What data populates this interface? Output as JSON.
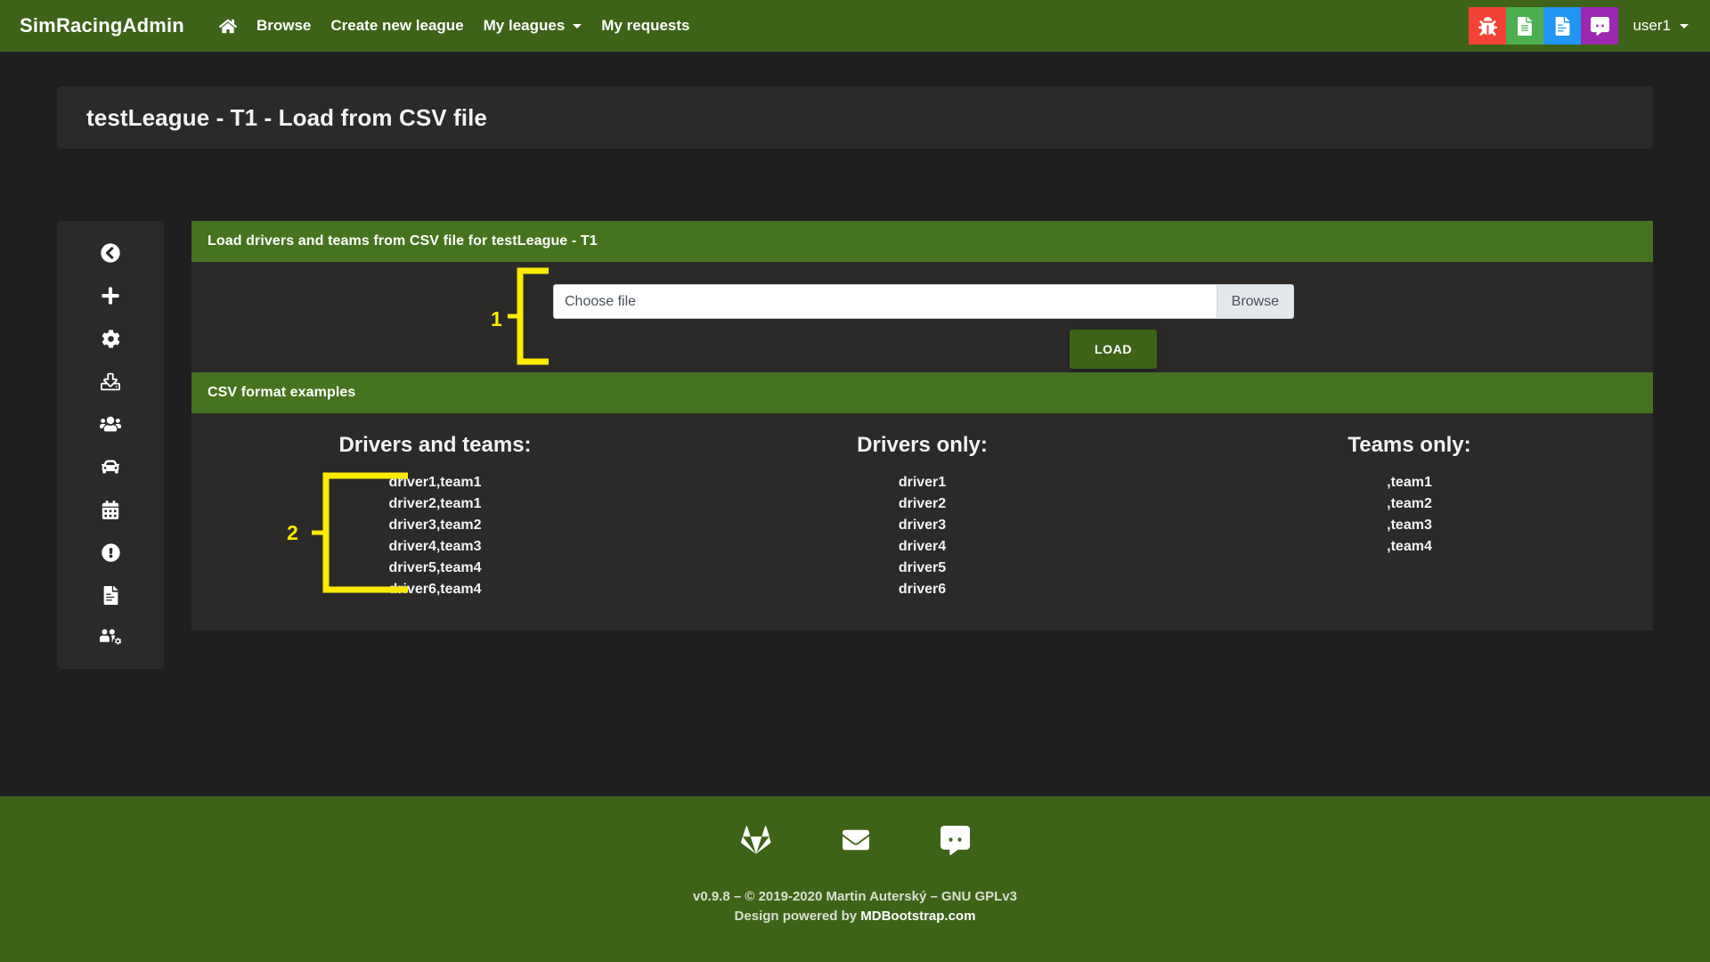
{
  "navbar": {
    "brand": "SimRacingAdmin",
    "home_icon": "home-icon",
    "links": [
      {
        "label": "Browse",
        "name": "nav-browse"
      },
      {
        "label": "Create new league",
        "name": "nav-create-new-league"
      },
      {
        "label": "My leagues",
        "name": "nav-my-leagues",
        "dropdown": true
      },
      {
        "label": "My requests",
        "name": "nav-my-requests"
      }
    ],
    "actions": [
      {
        "icon": "bug-icon",
        "color": "#f44336"
      },
      {
        "icon": "file-lines-icon",
        "color": "#4caf50"
      },
      {
        "icon": "file-signature-icon",
        "color": "#2196f3"
      },
      {
        "icon": "discord-icon",
        "color": "#9c27b0"
      }
    ],
    "user": "user1"
  },
  "page": {
    "title": "testLeague - T1 - Load from CSV file"
  },
  "sidebar": {
    "items": [
      {
        "icon": "circle-chevron-left-icon",
        "name": "sidebar-item-back"
      },
      {
        "icon": "plus-icon",
        "name": "sidebar-item-add"
      },
      {
        "icon": "gear-icon",
        "name": "sidebar-item-settings"
      },
      {
        "icon": "upload-icon",
        "name": "sidebar-item-upload"
      },
      {
        "icon": "users-icon",
        "name": "sidebar-item-drivers"
      },
      {
        "icon": "car-icon",
        "name": "sidebar-item-cars"
      },
      {
        "icon": "calendar-icon",
        "name": "sidebar-item-calendar"
      },
      {
        "icon": "exclamation-circle-icon",
        "name": "sidebar-item-penalties"
      },
      {
        "icon": "file-lines-icon",
        "name": "sidebar-item-results"
      },
      {
        "icon": "users-gear-icon",
        "name": "sidebar-item-manage-users"
      }
    ]
  },
  "upload_card": {
    "header": "Load drivers and teams from CSV file for testLeague - T1",
    "file_input_value": "Choose file",
    "file_input_placeholder": "Choose file",
    "browse_label": "Browse",
    "load_label": "LOAD"
  },
  "examples_card": {
    "header": "CSV format examples",
    "columns": [
      {
        "heading": "Drivers and teams:",
        "lines": [
          "driver1,team1",
          "driver2,team1",
          "driver3,team2",
          "driver4,team3",
          "driver5,team4",
          "driver6,team4"
        ]
      },
      {
        "heading": "Drivers only:",
        "lines": [
          "driver1",
          "driver2",
          "driver3",
          "driver4",
          "driver5",
          "driver6"
        ]
      },
      {
        "heading": "Teams only:",
        "lines": [
          ",team1",
          ",team2",
          ",team3",
          ",team4"
        ]
      }
    ]
  },
  "annotations": {
    "color": "#ffeb00",
    "items": [
      {
        "label": "1",
        "target": "file-upload-group"
      },
      {
        "label": "2",
        "target": "drivers-and-teams-example"
      }
    ]
  },
  "footer": {
    "icons": [
      {
        "icon": "gitlab-icon",
        "name": "footer-gitlab-link"
      },
      {
        "icon": "envelope-icon",
        "name": "footer-email-link"
      },
      {
        "icon": "discord-icon",
        "name": "footer-discord-link"
      }
    ],
    "line1": "v0.9.8 – © 2019-2020 Martin Auterský – GNU GPLv3",
    "line2_prefix": "Design powered by ",
    "line2_link": "MDBootstrap.com"
  },
  "colors": {
    "brand_green": "#3d6318",
    "card_green": "#46731f",
    "panel_dark": "#2b2a28",
    "page_dark": "#1f1f1f",
    "annotation_yellow": "#ffeb00"
  }
}
